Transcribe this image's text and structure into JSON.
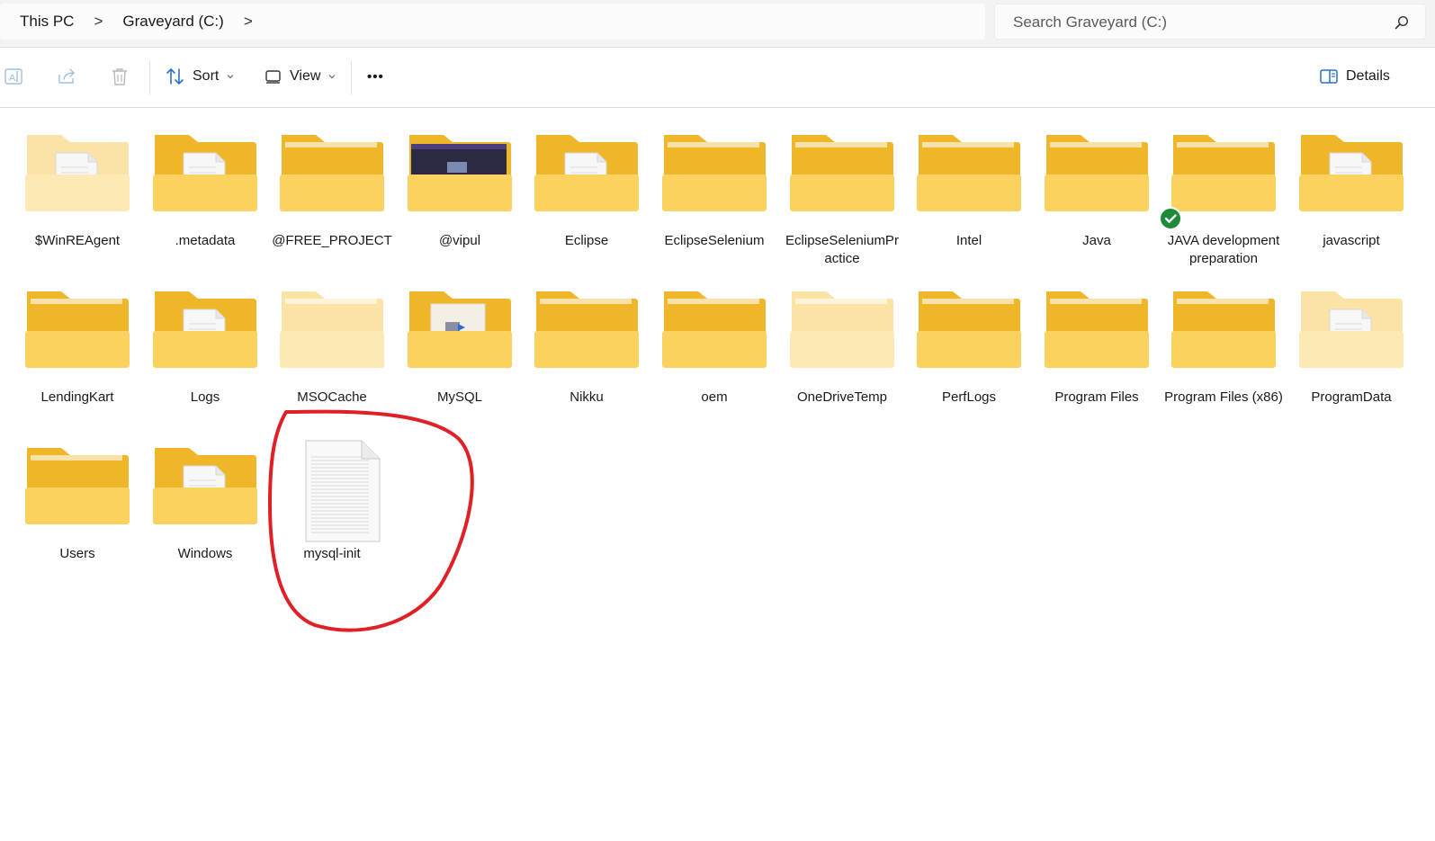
{
  "breadcrumb": {
    "items": [
      "This PC",
      "Graveyard (C:)"
    ],
    "separator": ">"
  },
  "search": {
    "placeholder": "Search Graveyard (C:)"
  },
  "toolbar": {
    "sort_label": "Sort",
    "view_label": "View",
    "more_label": "•••",
    "details_label": "Details"
  },
  "items": [
    {
      "name": "$WinREAgent",
      "type": "folder",
      "style": "pale-doc"
    },
    {
      "name": ".metadata",
      "type": "folder",
      "style": "doc"
    },
    {
      "name": "@FREE_PROJECT",
      "type": "folder",
      "style": "plain"
    },
    {
      "name": "@vipul",
      "type": "folder",
      "style": "screenshot"
    },
    {
      "name": "Eclipse",
      "type": "folder",
      "style": "doc"
    },
    {
      "name": "EclipseSelenium",
      "type": "folder",
      "style": "plain"
    },
    {
      "name": "EclipseSeleniumPractice",
      "type": "folder",
      "style": "plain",
      "label_lines": [
        "EclipseSeleniumPr",
        "actice"
      ]
    },
    {
      "name": "Intel",
      "type": "folder",
      "style": "plain"
    },
    {
      "name": "Java",
      "type": "folder",
      "style": "plain"
    },
    {
      "name": "JAVA development preparation",
      "type": "folder",
      "style": "plain",
      "synced": true
    },
    {
      "name": "javascript",
      "type": "folder",
      "style": "doc"
    },
    {
      "name": "LendingKart",
      "type": "folder",
      "style": "plain"
    },
    {
      "name": "Logs",
      "type": "folder",
      "style": "doc"
    },
    {
      "name": "MSOCache",
      "type": "folder",
      "style": "pale"
    },
    {
      "name": "MySQL",
      "type": "folder",
      "style": "image"
    },
    {
      "name": "Nikku",
      "type": "folder",
      "style": "plain"
    },
    {
      "name": "oem",
      "type": "folder",
      "style": "plain"
    },
    {
      "name": "OneDriveTemp",
      "type": "folder",
      "style": "pale"
    },
    {
      "name": "PerfLogs",
      "type": "folder",
      "style": "plain"
    },
    {
      "name": "Program Files",
      "type": "folder",
      "style": "plain"
    },
    {
      "name": "Program Files (x86)",
      "type": "folder",
      "style": "plain"
    },
    {
      "name": "ProgramData",
      "type": "folder",
      "style": "pale-doc"
    },
    {
      "name": "Users",
      "type": "folder",
      "style": "plain"
    },
    {
      "name": "Windows",
      "type": "folder",
      "style": "doc"
    },
    {
      "name": "mysql-init",
      "type": "file",
      "style": "text"
    }
  ],
  "colors": {
    "folder_back": "#f0b629",
    "folder_front": "#fbd160",
    "annotation": "#e01f26",
    "sync_badge": "#1b8a3a"
  },
  "annotation": {
    "target": "mysql-init",
    "shape": "hand-drawn circle"
  }
}
